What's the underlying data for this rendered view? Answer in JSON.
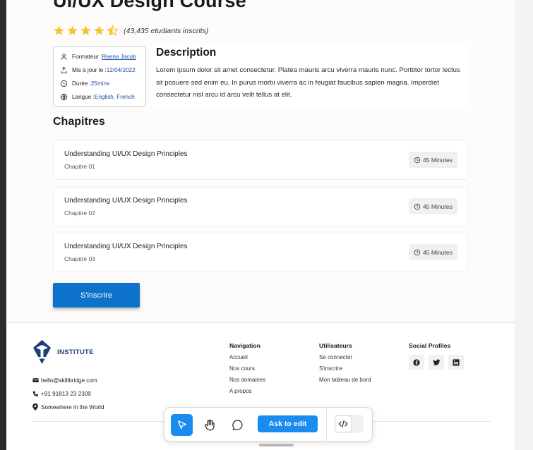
{
  "course": {
    "title": "UI/UX Design Course",
    "rating_value": 4.5,
    "rating_max": 5,
    "rating_text": "(43,435 etudiants inscrits)"
  },
  "meta": {
    "trainer_label": "Formateur : ",
    "trainer_value": "Reena Jacob",
    "updated_label": "Mis à jour le : ",
    "updated_value": "12/04/2022",
    "duration_label": "Durée : ",
    "duration_value": "25mins",
    "language_label": "Langue : ",
    "language_value": "English, French"
  },
  "description": {
    "title": "Description",
    "text": "Lorem ipsum dolor sit amet consectetur. Platea mauris arcu viverra mauris nunc. Porttitor tortor lectus sit posuere sed enim eu. In purus morbi viverra ac in feugiat faucibus sapien magna. Imperdiet consectetur nisl arcu id arcu velit tellus at elit."
  },
  "chapters_heading": "Chapitres",
  "chapters": [
    {
      "title": "Understanding UI/UX Design Principles",
      "subtitle": "Chapitre 01",
      "duration": "45 Minutes"
    },
    {
      "title": "Understanding UI/UX Design Principles",
      "subtitle": "Chapitre 02",
      "duration": "45 Minutes"
    },
    {
      "title": "Understanding UI/UX Design Principles",
      "subtitle": "Chapitre 03",
      "duration": "45 Minutes"
    }
  ],
  "enroll_label": "S'inscrire",
  "footer": {
    "brand": "INSTITUTE",
    "email": "hello@skillbridge.com",
    "phone": "+91 91813 23 2309",
    "address": "Somewhere in the World",
    "navigation": {
      "heading": "Navigation",
      "links": [
        "Accueil",
        "Nos cours",
        "Nos domaines",
        "A propos"
      ]
    },
    "users": {
      "heading": "Utilisateurs",
      "links": [
        "Se connecter",
        "S'inscrire",
        "Mon tableau de bord"
      ]
    },
    "social": {
      "heading": "Social Profiles",
      "icons": [
        "facebook-icon",
        "twitter-icon",
        "linkedin-icon"
      ]
    }
  },
  "toolbar": {
    "ask_label": "Ask to edit",
    "active_tool": "select",
    "accent": "#1a8cf0"
  },
  "colors": {
    "primary_button": "#0d72c9",
    "star": "#f4c430",
    "link": "#1a4fa0"
  }
}
